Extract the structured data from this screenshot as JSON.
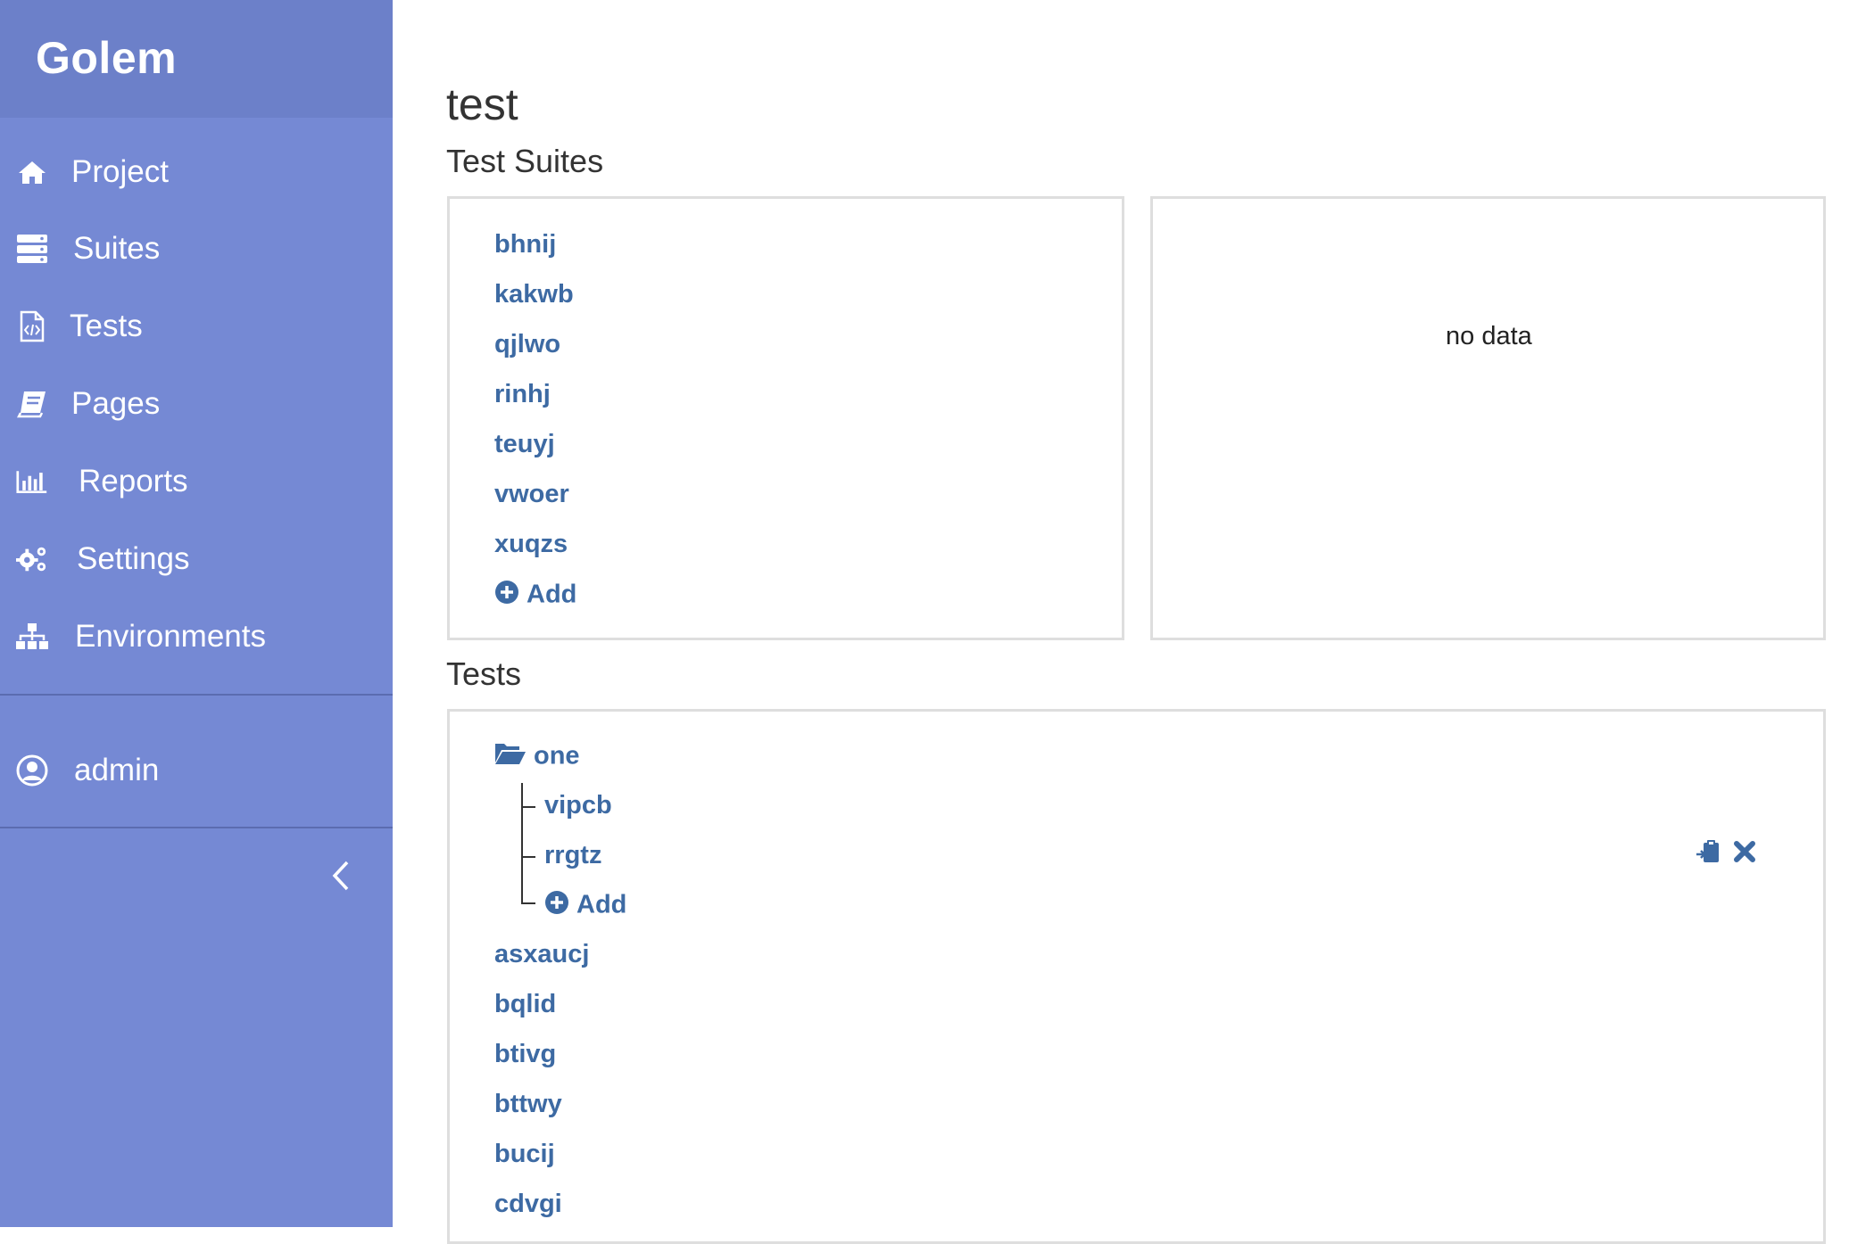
{
  "app": {
    "name": "Golem"
  },
  "sidebar": {
    "items": [
      {
        "label": "Project",
        "icon": "home-icon"
      },
      {
        "label": "Suites",
        "icon": "server-icon"
      },
      {
        "label": "Tests",
        "icon": "code-file-icon"
      },
      {
        "label": "Pages",
        "icon": "book-icon"
      },
      {
        "label": "Reports",
        "icon": "bar-chart-icon"
      },
      {
        "label": "Settings",
        "icon": "gears-icon"
      },
      {
        "label": "Environments",
        "icon": "sitemap-icon"
      }
    ],
    "user": {
      "label": "admin",
      "icon": "user-circle-icon"
    },
    "collapse_icon": "chevron-left-icon"
  },
  "main": {
    "title": "test",
    "suites_section": {
      "heading": "Test Suites",
      "items": [
        "bhnij",
        "kakwb",
        "qjlwo",
        "rinhj",
        "teuyj",
        "vwoer",
        "xuqzs"
      ],
      "add_label": "Add",
      "side_panel_text": "no data"
    },
    "tests_section": {
      "heading": "Tests",
      "folder": {
        "name": "one",
        "children": [
          "vipcb",
          "rrgtz"
        ],
        "add_label": "Add"
      },
      "items": [
        "asxaucj",
        "bqlid",
        "btivg",
        "bttwy",
        "bucij",
        "cdvgi"
      ]
    }
  },
  "colors": {
    "sidebar": "#7589d4",
    "brand": "#6c80c9",
    "link": "#3d6aa3"
  }
}
